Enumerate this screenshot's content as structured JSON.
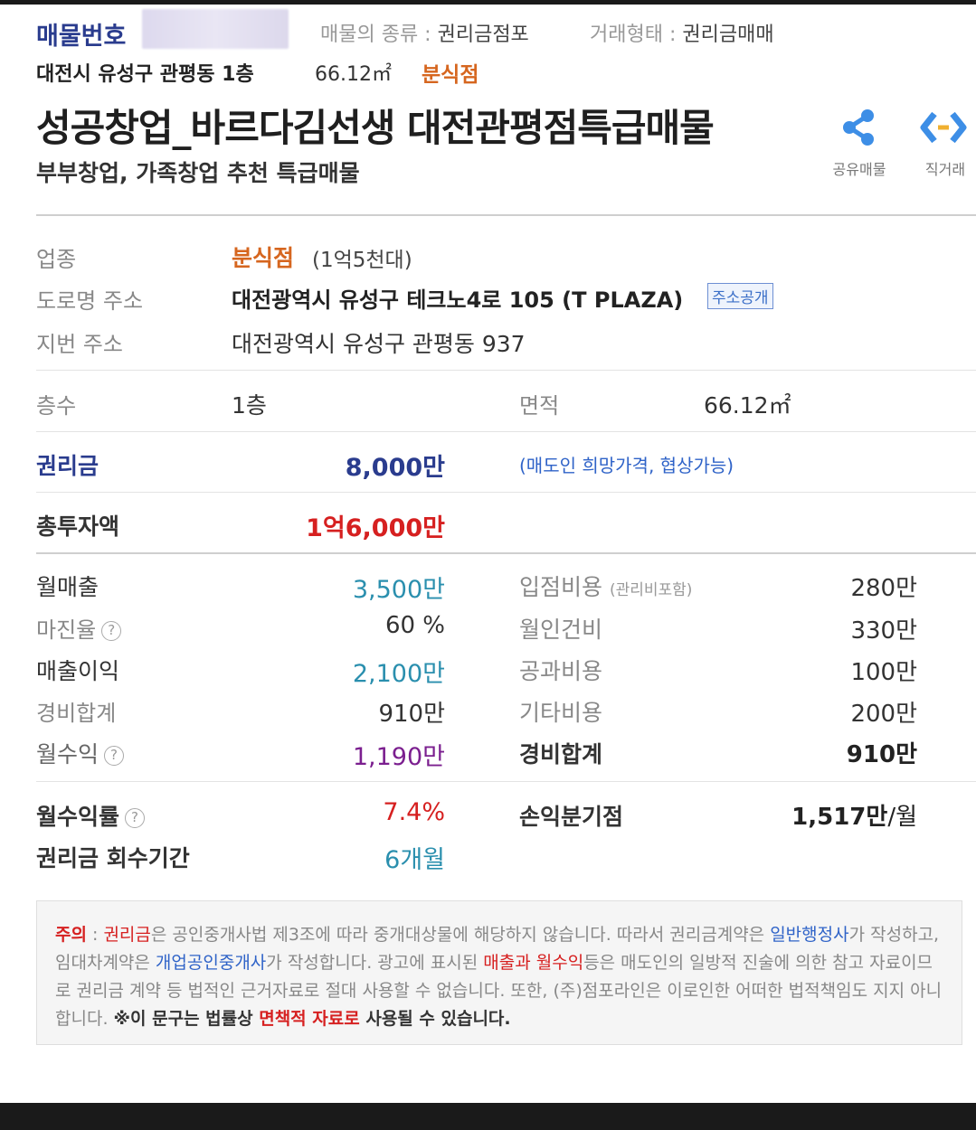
{
  "header": {
    "listing_no_label": "매물번호",
    "type_label": "매물의 종류 : ",
    "type_value": "권리금점포",
    "deal_label": "거래형태 : ",
    "deal_value": "권리금매매",
    "location": "대전시 유성구 관평동 1층",
    "area": "66.12㎡",
    "category": "분식점",
    "title": "성공창업_바르다김선생 대전관평점특급매물",
    "subtitle": "부부창업, 가족창업 추천 특급매물",
    "share_label": "공유매물",
    "direct_label": "직거래"
  },
  "info": {
    "biz_label": "업종",
    "biz_value": "분식점",
    "biz_range": "(1억5천대)",
    "road_label": "도로명 주소",
    "road_value": "대전광역시 유성구 테크노4로 105 (T PLAZA)",
    "address_badge": "주소공개",
    "lot_label": "지번 주소",
    "lot_value": "대전광역시 유성구 관평동 937"
  },
  "floor": {
    "floor_label": "층수",
    "floor_value": "1층",
    "area_label": "면적",
    "area_value": "66.12㎡"
  },
  "premium": {
    "label": "권리금",
    "value": "8,000만",
    "note": "(매도인 희망가격, 협상가능)"
  },
  "total": {
    "label": "총투자액",
    "value": "1억6,000만"
  },
  "finance_left": [
    {
      "label": "월매출",
      "value": "3,500만",
      "help": false
    },
    {
      "label": "마진율",
      "value": "60 %",
      "help": true
    },
    {
      "label": "매출이익",
      "value": "2,100만",
      "help": false
    },
    {
      "label": "경비합계",
      "value": "910만",
      "help": false
    },
    {
      "label": "월수익",
      "value": "1,190만",
      "help": true
    }
  ],
  "finance_right": [
    {
      "label": "입점비용",
      "sub": "(관리비포함)",
      "value": "280만"
    },
    {
      "label": "월인건비",
      "value": "330만"
    },
    {
      "label": "공과비용",
      "value": "100만"
    },
    {
      "label": "기타비용",
      "value": "200만"
    },
    {
      "label": "경비합계",
      "value": "910만"
    }
  ],
  "summary": {
    "yield_label": "월수익률",
    "yield_value": "7.4%",
    "payback_label": "권리금 회수기간",
    "payback_value": "6개월",
    "bep_label": "손익분기점",
    "bep_value": "1,517만",
    "bep_unit": "/월"
  },
  "help_glyph": "?",
  "notice": {
    "p1": "주의",
    "p2": " : ",
    "p3": "권리금",
    "p4": "은 공인중개사법 제3조에 따라 중개대상물에 해당하지 않습니다. 따라서 권리금계약은 ",
    "p5": "일반행정사",
    "p6": "가 작성하고, 임대차계약은 ",
    "p7": "개업공인중개사",
    "p8": "가 작성합니다. 광고에 표시된 ",
    "p9": "매출과 월수익",
    "p10": "등은 매도인의 일방적 진술에 의한 참고 자료이므로 권리금 계약 등 법적인 근거자료로 절대 사용할 수 없습니다. 또한, (주)점포라인은 이로인한 어떠한 법적책임도 지지 아니합니다. ",
    "p11": "※이 문구는 법률상 ",
    "p12": "면책적 자료로",
    "p13": " 사용될 수 있습니다."
  },
  "colors": {
    "navy": "#2a3c8e",
    "orange": "#d6661f",
    "teal": "#2a8fae",
    "purple": "#7b1f8f",
    "red": "#d62020"
  }
}
